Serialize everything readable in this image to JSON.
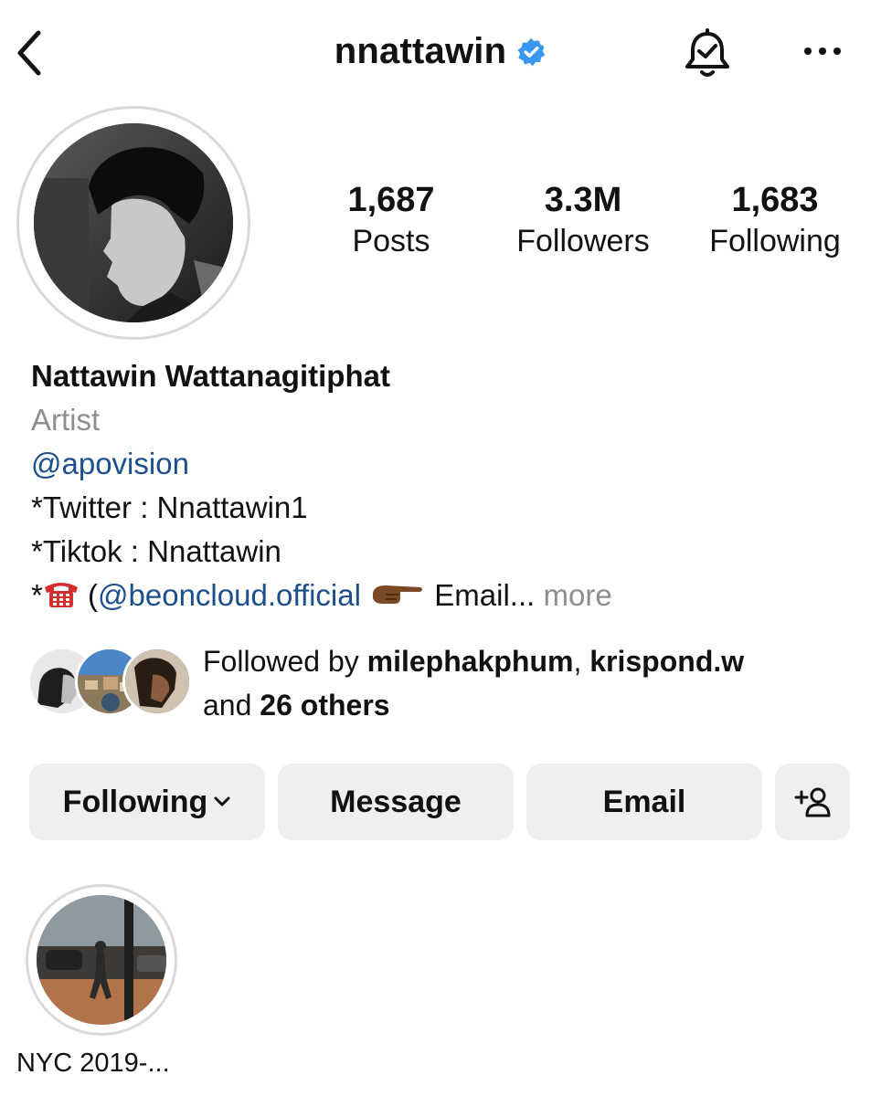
{
  "header": {
    "username": "nnattawin",
    "verified_icon": "verified-badge-icon",
    "back_icon": "chevron-left-icon",
    "notification_icon": "bell-check-icon",
    "more_icon": "ellipsis-icon"
  },
  "stats": {
    "posts_value": "1,687",
    "posts_label": "Posts",
    "followers_value": "3.3M",
    "followers_label": "Followers",
    "following_value": "1,683",
    "following_label": "Following"
  },
  "bio": {
    "name": "Nattawin Wattanagitiphat",
    "category": "Artist",
    "mention": "@apovision",
    "line_twitter": "*Twitter : Nnattawin1",
    "line_tiktok": "*Tiktok : Nnattawin",
    "line4_prefix": "*",
    "line4_paren": " (",
    "line4_mention": "@beoncloud.official",
    "line4_email": " Email...",
    "more": " more"
  },
  "followed_by": {
    "prefix": "Followed by ",
    "user1": "milephakphum",
    "separator": ", ",
    "user2": "krispond.w",
    "and_text": "and ",
    "others": "26 others"
  },
  "buttons": {
    "following": "Following",
    "message": "Message",
    "email": "Email",
    "add_user_icon": "add-user-icon"
  },
  "highlights": [
    {
      "label": "NYC 2019-..."
    }
  ],
  "colors": {
    "link": "#1d4f8f",
    "muted": "#8e8e8e",
    "verified": "#3897f0",
    "button_bg": "#efefef"
  }
}
